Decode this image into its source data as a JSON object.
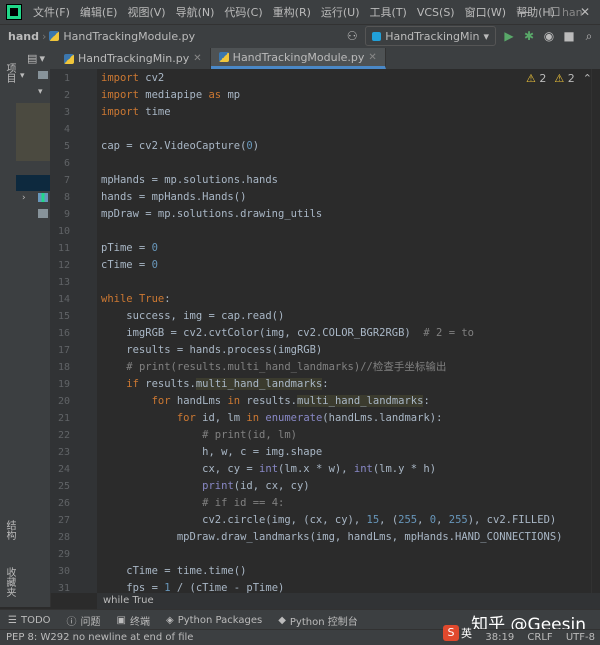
{
  "menubar": {
    "items": [
      "文件(F)",
      "编辑(E)",
      "视图(V)",
      "导航(N)",
      "代码(C)",
      "重构(R)",
      "运行(U)",
      "工具(T)",
      "VCS(S)",
      "窗口(W)",
      "帮助(H)"
    ],
    "title_fragment": "han"
  },
  "navbar": {
    "project": "hand",
    "file": "HandTrackingModule.py",
    "run_config": "HandTrackingMin"
  },
  "tabs": [
    {
      "label": "HandTrackingMin.py",
      "active": false
    },
    {
      "label": "HandTrackingModule.py",
      "active": true
    }
  ],
  "left_strip": {
    "project_label": "项目",
    "structure_label": "结构",
    "favorites_label": "收藏夹"
  },
  "inspections": {
    "warnings_a": "2",
    "warnings_b": "2"
  },
  "editor": {
    "line_numbers": [
      "1",
      "2",
      "3",
      "4",
      "5",
      "6",
      "7",
      "8",
      "9",
      "10",
      "11",
      "12",
      "13",
      "14",
      "15",
      "16",
      "17",
      "18",
      "19",
      "20",
      "21",
      "22",
      "23",
      "24",
      "25",
      "26",
      "27",
      "28",
      "29",
      "30",
      "31"
    ],
    "lines": [
      "import cv2",
      "import mediapipe as mp",
      "import time",
      "",
      "cap = cv2.VideoCapture(0)",
      "",
      "mpHands = mp.solutions.hands",
      "hands = mpHands.Hands()",
      "mpDraw = mp.solutions.drawing_utils",
      "",
      "pTime = 0",
      "cTime = 0",
      "",
      "while True:",
      "    success, img = cap.read()",
      "    imgRGB = cv2.cvtColor(img, cv2.COLOR_BGR2RGB)  # 2 = to",
      "    results = hands.process(imgRGB)",
      "    # print(results.multi_hand_landmarks)//检查手坐标输出",
      "    if results.multi_hand_landmarks:",
      "        for handLms in results.multi_hand_landmarks:",
      "            for id, lm in enumerate(handLms.landmark):",
      "                # print(id, lm)",
      "                h, w, c = img.shape",
      "                cx, cy = int(lm.x * w), int(lm.y * h)",
      "                print(id, cx, cy)",
      "                # if id == 4:",
      "                cv2.circle(img, (cx, cy), 15, (255, 0, 255), cv2.FILLED)",
      "            mpDraw.draw_landmarks(img, handLms, mpHands.HAND_CONNECTIONS)",
      "",
      "    cTime = time.time()",
      "    fps = 1 / (cTime - pTime)"
    ]
  },
  "breadcrumb": "while True",
  "toolwindows": [
    "TODO",
    "问题",
    "终端",
    "Python Packages",
    "Python 控制台"
  ],
  "status": {
    "message": "PEP 8: W292 no newline at end of file",
    "position": "38:19",
    "line_sep": "CRLF",
    "encoding": "UTF-8"
  },
  "watermark": "知乎 @Geesin",
  "ime": {
    "badge": "S",
    "mode": "英"
  }
}
